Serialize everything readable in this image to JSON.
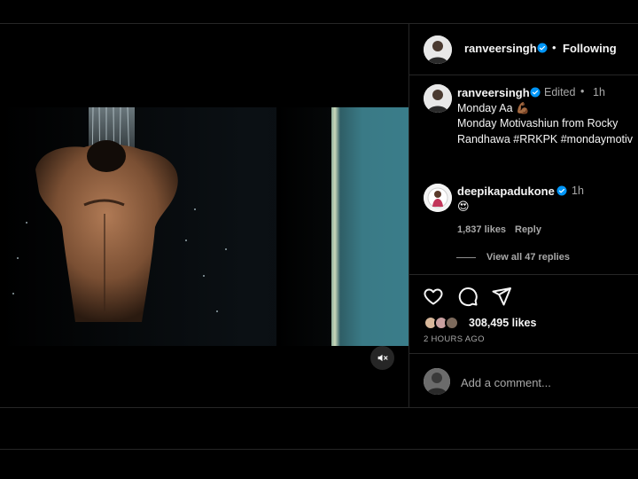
{
  "post": {
    "author": "ranveersingh",
    "follow_label": "Following",
    "caption": {
      "username": "ranveersingh",
      "edited": "Edited",
      "time": "1h",
      "line1": "Monday Aa 💪🏾",
      "line2": "Monday Motivashiun from Rocky",
      "line3": "Randhawa #RRKPK #mondaymotiv"
    },
    "comment": {
      "username": "deepikapadukone",
      "time": "1h",
      "text": "😍",
      "likes": "1,837 likes",
      "reply_label": "Reply",
      "view_replies": "View all 47 replies"
    },
    "likes_count": "308,495 likes",
    "posted_ago": "2 HOURS AGO",
    "add_comment_placeholder": "Add a comment..."
  },
  "icons": [
    "verified-icon",
    "mute-icon",
    "heart-icon",
    "comment-icon",
    "share-icon"
  ],
  "colors": {
    "verified": "#0095f6",
    "background": "#000000",
    "muted_text": "#a8a8a8"
  }
}
